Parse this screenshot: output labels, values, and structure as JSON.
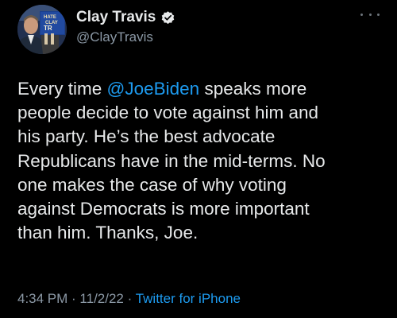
{
  "author": {
    "display_name": "Clay Travis",
    "handle": "@ClayTravis",
    "avatar_sign_lines": [
      "HATE",
      "CLAY",
      "TR"
    ]
  },
  "tweet": {
    "line1_prefix": "Every time ",
    "mention": "@JoeBiden",
    "line1_suffix": " speaks more",
    "line2": "people decide to vote against him and",
    "line3": "his party. He’s the best advocate",
    "line4": "Republicans have in the mid-terms. No",
    "line5": "one makes the case of why voting",
    "line6": "against Democrats is more important",
    "line7": "than him. Thanks, Joe."
  },
  "meta": {
    "time": "4:34 PM",
    "separator1": " · ",
    "date": "11/2/22",
    "separator2": " · ",
    "source": "Twitter for iPhone"
  },
  "icons": {
    "verified": "verified-badge-icon",
    "more": "more-options-icon"
  },
  "colors": {
    "background": "#000000",
    "text": "#e7e9ea",
    "secondary": "#8b98a5",
    "accent": "#1d9bf0"
  }
}
